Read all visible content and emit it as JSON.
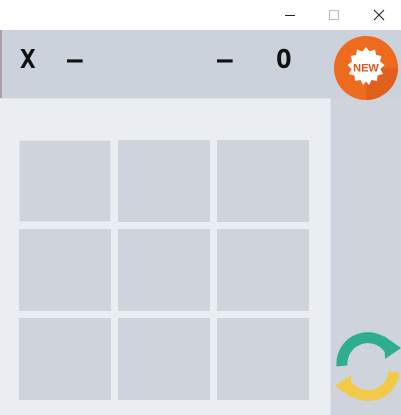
{
  "window": {
    "minimize_icon": "minimize-icon",
    "maximize_icon": "maximize-icon",
    "close_icon": "close-icon"
  },
  "scoreboard": {
    "player1_mark": "X",
    "player1_score": "–",
    "player2_score": "–",
    "player2_mark": "O"
  },
  "new_game": {
    "label": "NEW",
    "icon": "new-badge-icon",
    "color": "#E8621F"
  },
  "board": {
    "cells": [
      "",
      "",
      "",
      "",
      "",
      "",
      "",
      "",
      ""
    ],
    "highlighted_cell": 0
  },
  "restart": {
    "icon": "refresh-arrows-icon",
    "colors": [
      "#2FAE8F",
      "#F3C94A"
    ]
  }
}
